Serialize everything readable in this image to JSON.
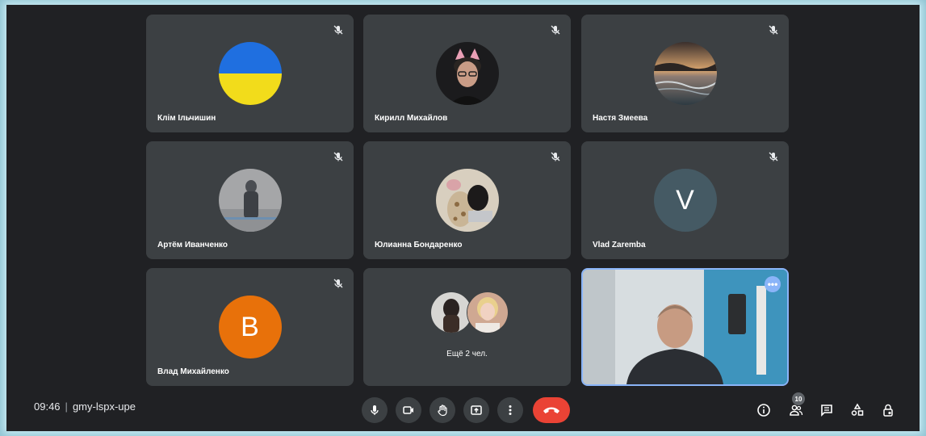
{
  "participants": [
    {
      "name": "Клім Ільчишин",
      "avatar": "ukraine-flag-avatar"
    },
    {
      "name": "Кирилл Михайлов",
      "avatar": "photo-avatar"
    },
    {
      "name": "Настя Змеева",
      "avatar": "sunset-sea-avatar"
    },
    {
      "name": "Артём Иванченко",
      "avatar": "photo-avatar"
    },
    {
      "name": "Юлианна Бондаренко",
      "avatar": "photo-avatar"
    },
    {
      "name": "Vlad Zaremba",
      "avatar_letter": "V",
      "avatar_color": "#455a64"
    },
    {
      "name": "Влад Михайленко",
      "avatar_letter": "B",
      "avatar_color": "#e8710a"
    }
  ],
  "more": {
    "label": "Ещё 2 чел."
  },
  "meeting": {
    "time": "09:46",
    "separator": "|",
    "code": "gmy-lspx-upe"
  },
  "people_count": "10",
  "colors": {
    "background": "#202124",
    "tile": "#3c4043",
    "hangup": "#ea4335",
    "accent": "#8ab4f8"
  }
}
